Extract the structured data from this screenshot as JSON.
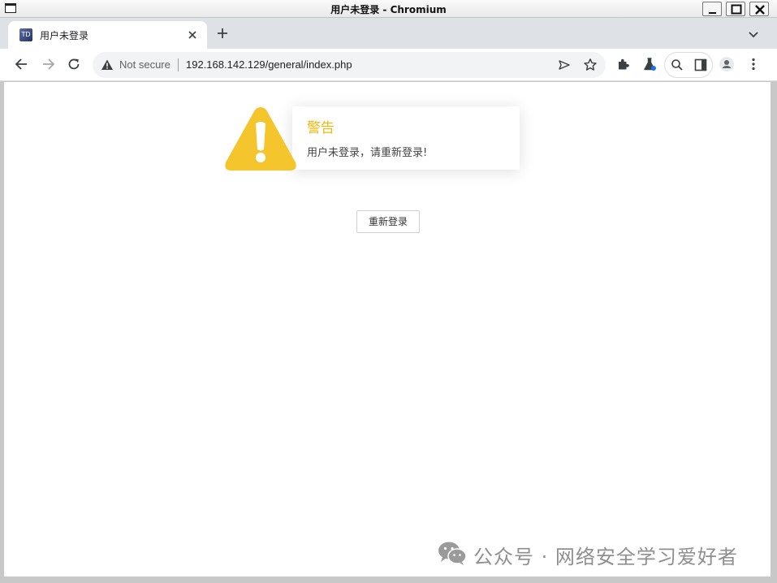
{
  "window": {
    "title": "用户未登录 - Chromium"
  },
  "tab": {
    "favicon_text": "TD",
    "title": "用户未登录"
  },
  "omnibox": {
    "security_label": "Not secure",
    "url": "192.168.142.129/general/index.php"
  },
  "alert": {
    "title": "警告",
    "message": "用户未登录，请重新登录!",
    "icon": "warning-triangle-icon",
    "icon_color": "#f4c52d",
    "title_color": "#f0b90b"
  },
  "relogin_button": {
    "label": "重新登录"
  },
  "watermark": {
    "text": "公众号 · 网络安全学习爱好者",
    "icon": "wechat-icon"
  }
}
